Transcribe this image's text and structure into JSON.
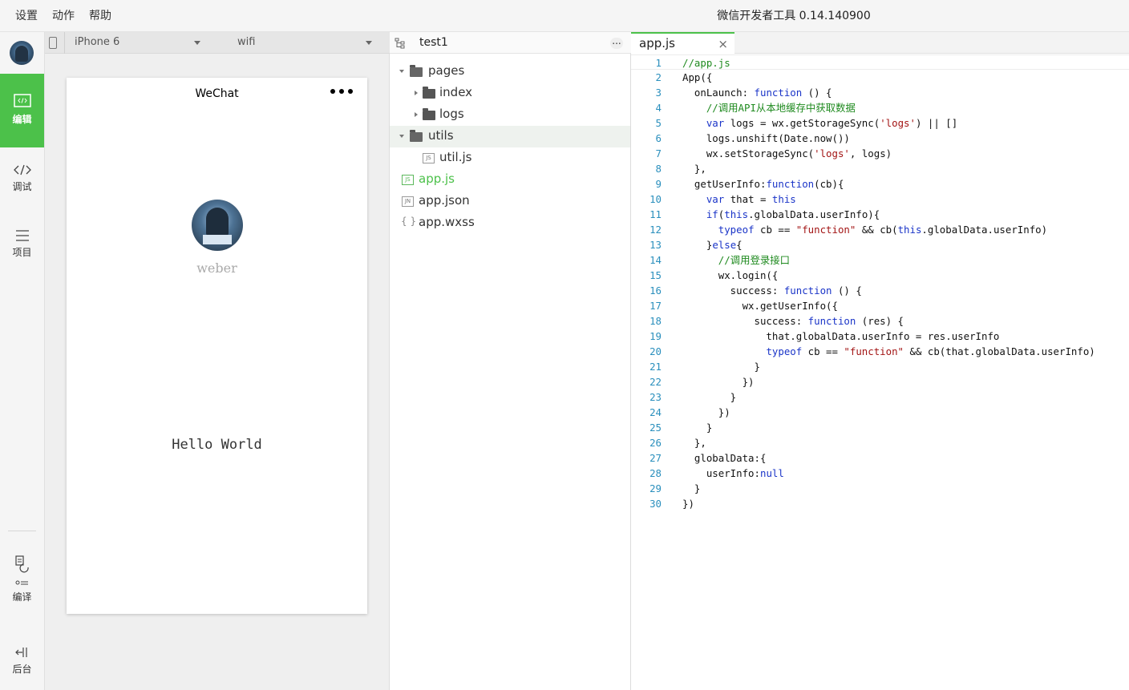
{
  "titlebar": {
    "menu": [
      "设置",
      "动作",
      "帮助"
    ],
    "title": "微信开发者工具 0.14.140900"
  },
  "sidebar": {
    "items": [
      {
        "label": "编辑",
        "icon": "code-window-icon",
        "active": true
      },
      {
        "label": "调试",
        "icon": "code-brackets-icon",
        "active": false
      },
      {
        "label": "项目",
        "icon": "menu-lines-icon",
        "active": false
      },
      {
        "label": "编译",
        "icon": "compile-icon",
        "active": false
      },
      {
        "label": "后台",
        "icon": "background-icon",
        "active": false
      }
    ],
    "accent": "#4cc14a"
  },
  "simulator": {
    "device": "iPhone 6",
    "network": "wifi",
    "phone": {
      "nav_title": "WeChat",
      "user_name": "weber",
      "hello": "Hello World"
    }
  },
  "tree": {
    "project": "test1",
    "items": [
      {
        "name": "pages",
        "type": "folder-open"
      },
      {
        "name": "index",
        "type": "folder"
      },
      {
        "name": "logs",
        "type": "folder"
      },
      {
        "name": "utils",
        "type": "folder-open"
      },
      {
        "name": "util.js",
        "type": "js",
        "badge": "JS"
      },
      {
        "name": "app.js",
        "type": "js",
        "badge": "JS"
      },
      {
        "name": "app.json",
        "type": "json",
        "badge": "JN"
      },
      {
        "name": "app.wxss",
        "type": "wxss",
        "badge": "{ }"
      }
    ]
  },
  "editor": {
    "tab": "app.js",
    "close_glyph": "×",
    "lines": [
      "1",
      "2",
      "3",
      "4",
      "5",
      "6",
      "7",
      "8",
      "9",
      "10",
      "11",
      "12",
      "13",
      "14",
      "15",
      "16",
      "17",
      "18",
      "19",
      "20",
      "21",
      "22",
      "23",
      "24",
      "25",
      "26",
      "27",
      "28",
      "29",
      "30"
    ]
  }
}
